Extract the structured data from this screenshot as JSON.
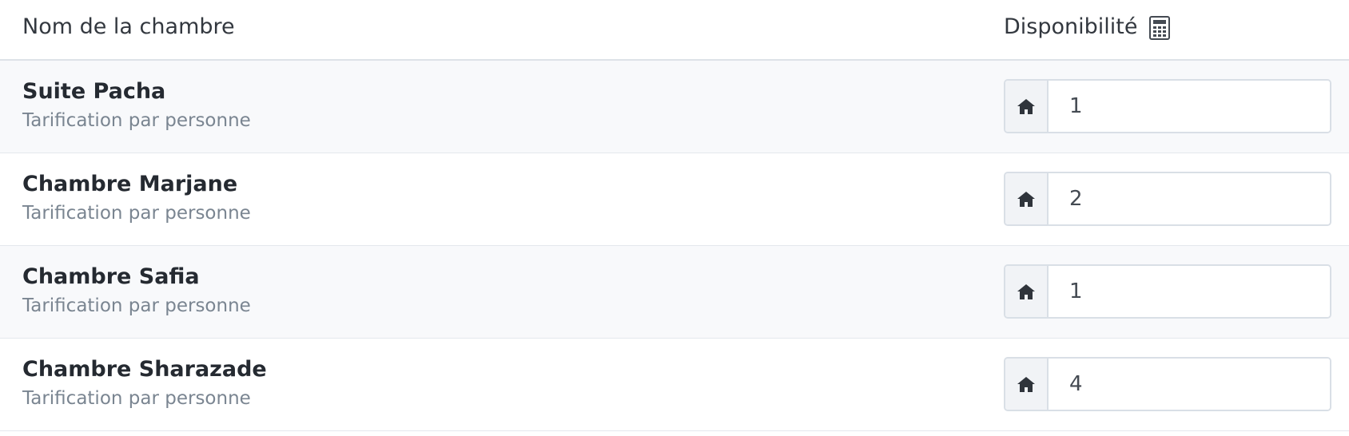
{
  "header": {
    "room_name_label": "Nom de la chambre",
    "availability_label": "Disponibilité",
    "availability_icon": "calculator-icon"
  },
  "rooms": [
    {
      "name": "Suite Pacha",
      "pricing": "Tarification par personne",
      "availability": "1",
      "icon": "home-icon"
    },
    {
      "name": "Chambre Marjane",
      "pricing": "Tarification par personne",
      "availability": "2",
      "icon": "home-icon"
    },
    {
      "name": "Chambre Safia",
      "pricing": "Tarification par personne",
      "availability": "1",
      "icon": "home-icon"
    },
    {
      "name": "Chambre Sharazade",
      "pricing": "Tarification par personne",
      "availability": "4",
      "icon": "home-icon"
    }
  ],
  "colors": {
    "odd_row_bg": "#f8f9fb",
    "text_dark": "#252a31",
    "text_muted": "#7a8591",
    "border": "#d9dfe6"
  }
}
